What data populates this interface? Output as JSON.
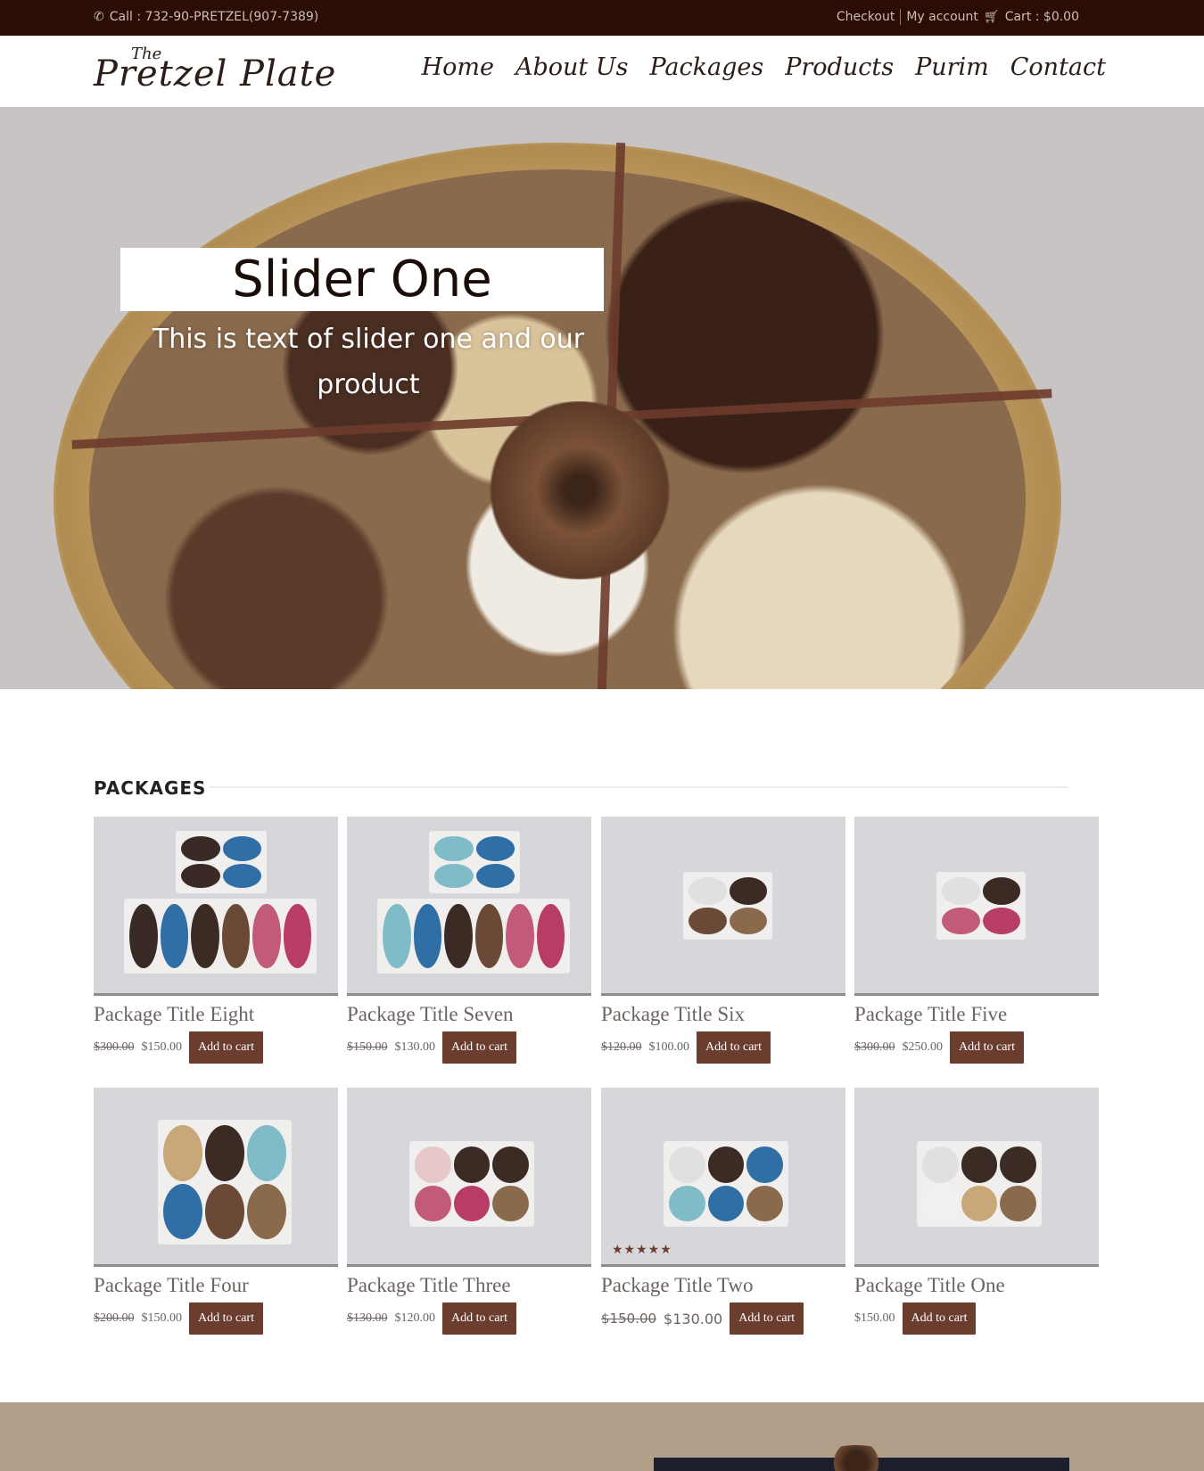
{
  "topbar": {
    "phone": "Call : 732-90-PRETZEL(907-7389)",
    "checkout": "Checkout",
    "my_account": "My account",
    "cart": "Cart : $0.00"
  },
  "header": {
    "logo_the": "The",
    "logo_name": "Pretzel Plate",
    "nav": [
      "Home",
      "About Us",
      "Packages",
      "Products",
      "Purim",
      "Contact"
    ]
  },
  "hero": {
    "title": "Slider One",
    "text": "This is text of slider one and our product"
  },
  "packages": {
    "heading": "PACKAGES",
    "items": [
      {
        "title": "Package Title Eight",
        "old": "$300.00",
        "price": "$150.00",
        "button": "Add to cart"
      },
      {
        "title": "Package Title Seven",
        "old": "$150.00",
        "price": "$130.00",
        "button": "Add to cart"
      },
      {
        "title": "Package Title Six",
        "old": "$120.00",
        "price": "$100.00",
        "button": "Add to cart"
      },
      {
        "title": "Package Title Five",
        "old": "$300.00",
        "price": "$250.00",
        "button": "Add to cart"
      },
      {
        "title": "Package Title Four",
        "old": "$200.00",
        "price": "$150.00",
        "button": "Add to cart"
      },
      {
        "title": "Package Title Three",
        "old": "$130.00",
        "price": "$120.00",
        "button": "Add to cart"
      },
      {
        "title": "Package Title Two",
        "old": "$150.00",
        "price": "$130.00",
        "button": "Add to cart",
        "rating": 5
      },
      {
        "title": "Package Title One",
        "old": "",
        "price": "$150.00",
        "button": "Add to cart"
      }
    ]
  },
  "colors": {
    "topbar": "#2b0d06",
    "button": "#6b3d2e",
    "band": "#b19f89"
  },
  "icons": {
    "phone": "phone-icon",
    "cart": "cart-icon",
    "star": "star-icon"
  }
}
